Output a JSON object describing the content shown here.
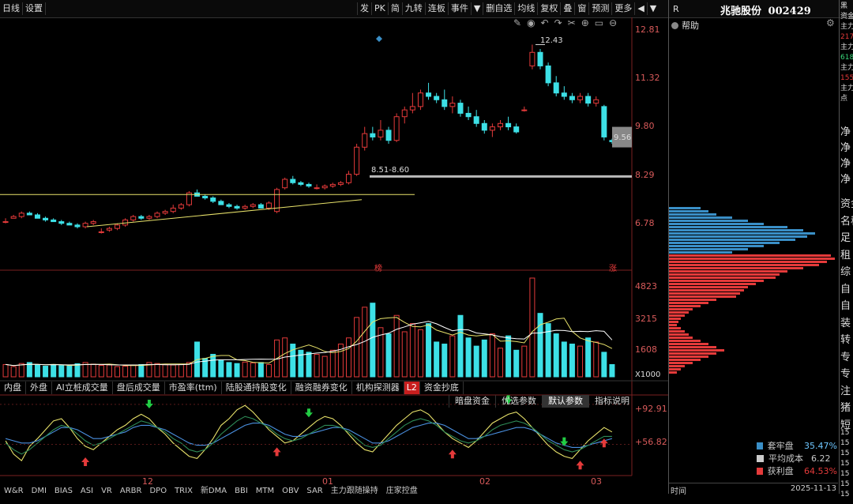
{
  "toolbar": {
    "left": [
      "日线",
      "设置"
    ],
    "right": [
      "发",
      "PK",
      "简",
      "九转",
      "连板",
      "事件",
      "▼",
      "删自选",
      "均线",
      "复权",
      "叠",
      "窗",
      "预测",
      "更多",
      "◀",
      "▼"
    ],
    "right_icons": [
      "pencil-icon",
      "eye-icon",
      "undo-icon",
      "scissors-icon",
      "add-icon",
      "minus-circle-icon"
    ]
  },
  "stock": {
    "market_tag": "R",
    "name": "兆驰股份",
    "code": "002429",
    "help": "帮助"
  },
  "price_axis": [
    "12.81",
    "11.32",
    "9.80",
    "8.29",
    "6.78"
  ],
  "price_annotations": {
    "high": "12.43",
    "current": "9.56",
    "band": "8.51-8.60",
    "marker_1": "榜",
    "marker_2": "涨"
  },
  "volume_axis": [
    "4823",
    "3215",
    "1608",
    "X1000"
  ],
  "indicator_axis": [
    "+92.91",
    "+56.82"
  ],
  "date_axis": [
    "12",
    "01",
    "02",
    "03"
  ],
  "analysis_tabs": [
    "内盘",
    "外盘",
    "AI立桩成交量",
    "盘后成交量",
    "市盈率(ttm)",
    "陆股通持股变化",
    "融资融券变化",
    "机构探测器",
    "L2",
    "资金抄底"
  ],
  "param_tabs": [
    "暗盘资金",
    "优选参数",
    "默认参数",
    "指标说明"
  ],
  "param_active": "默认参数",
  "bottom_tabs": [
    "W&R",
    "DMI",
    "BIAS",
    "ASI",
    "VR",
    "ARBR",
    "DPO",
    "TRIX",
    "新DMA",
    "BBI",
    "MTM",
    "OBV",
    "SAR",
    "主力跟随操持",
    "庄家控盘"
  ],
  "chip_legend": [
    {
      "label": "套牢盘",
      "value": "35.47%",
      "color": "#3a8fc7"
    },
    {
      "label": "平均成本",
      "value": "6.22",
      "color": "#cccccc"
    },
    {
      "label": "获利盘",
      "value": "64.53%",
      "color": "#e43a3a"
    }
  ],
  "chip_footer": {
    "left": "时间",
    "right": "2025-11-13"
  },
  "side_panel": {
    "top": [
      "黑",
      "资金",
      "主力",
      "217",
      "主力",
      "618",
      "主力",
      "155",
      "主力",
      "点"
    ],
    "mid": [
      "净",
      "净",
      "净",
      "净"
    ],
    "list": [
      "资金",
      "名称",
      "足",
      "租",
      "综",
      "自",
      "自",
      "装",
      "转",
      "专",
      "专",
      "注",
      "猪",
      "短"
    ],
    "numbers": [
      "15",
      "15",
      "15",
      "15",
      "15",
      "15",
      "15"
    ]
  },
  "chart_data": [
    {
      "type": "candlestick",
      "title": "",
      "ylim": [
        6.0,
        13.0
      ],
      "ohlc": [
        [
          7.2,
          7.3,
          7.15,
          7.2
        ],
        [
          7.3,
          7.4,
          7.3,
          7.35
        ],
        [
          7.35,
          7.5,
          7.3,
          7.45
        ],
        [
          7.45,
          7.5,
          7.4,
          7.4
        ],
        [
          7.4,
          7.45,
          7.3,
          7.3
        ],
        [
          7.3,
          7.35,
          7.2,
          7.25
        ],
        [
          7.25,
          7.3,
          7.2,
          7.2
        ],
        [
          7.2,
          7.25,
          7.1,
          7.15
        ],
        [
          7.15,
          7.2,
          7.1,
          7.1
        ],
        [
          7.1,
          7.15,
          7.0,
          7.05
        ],
        [
          7.05,
          7.2,
          7.0,
          7.15
        ],
        [
          7.15,
          7.25,
          7.1,
          7.2
        ],
        [
          6.9,
          7.0,
          6.85,
          6.9
        ],
        [
          6.95,
          7.05,
          6.9,
          7.0
        ],
        [
          7.0,
          7.15,
          6.95,
          7.1
        ],
        [
          7.1,
          7.3,
          7.05,
          7.25
        ],
        [
          7.25,
          7.4,
          7.2,
          7.35
        ],
        [
          7.35,
          7.4,
          7.25,
          7.3
        ],
        [
          7.3,
          7.4,
          7.25,
          7.35
        ],
        [
          7.35,
          7.5,
          7.3,
          7.45
        ],
        [
          7.45,
          7.55,
          7.4,
          7.5
        ],
        [
          7.5,
          7.7,
          7.45,
          7.6
        ],
        [
          7.6,
          7.75,
          7.55,
          7.7
        ],
        [
          7.7,
          8.1,
          7.65,
          8.05
        ],
        [
          8.05,
          8.15,
          7.95,
          7.95
        ],
        [
          7.95,
          8.0,
          7.85,
          7.9
        ],
        [
          7.9,
          7.95,
          7.75,
          7.8
        ],
        [
          7.8,
          7.85,
          7.7,
          7.7
        ],
        [
          7.7,
          7.75,
          7.6,
          7.65
        ],
        [
          7.65,
          7.7,
          7.55,
          7.6
        ],
        [
          7.6,
          7.7,
          7.55,
          7.65
        ],
        [
          7.65,
          7.75,
          7.6,
          7.7
        ],
        [
          7.7,
          7.75,
          7.6,
          7.6
        ],
        [
          7.6,
          7.8,
          7.55,
          7.75
        ],
        [
          7.5,
          8.2,
          7.45,
          8.15
        ],
        [
          8.2,
          8.5,
          8.15,
          8.45
        ],
        [
          8.45,
          8.55,
          8.3,
          8.35
        ],
        [
          8.35,
          8.4,
          8.25,
          8.3
        ],
        [
          8.3,
          8.35,
          8.2,
          8.25
        ],
        [
          8.2,
          8.3,
          8.15,
          8.2
        ],
        [
          8.2,
          8.3,
          8.15,
          8.25
        ],
        [
          8.25,
          8.35,
          8.2,
          8.3
        ],
        [
          8.3,
          8.4,
          8.25,
          8.35
        ],
        [
          8.35,
          8.7,
          8.3,
          8.6
        ],
        [
          8.6,
          9.5,
          8.55,
          9.4
        ],
        [
          9.4,
          10.0,
          9.3,
          9.8
        ],
        [
          9.8,
          10.0,
          9.6,
          9.7
        ],
        [
          9.7,
          10.2,
          9.6,
          9.9
        ],
        [
          9.9,
          10.0,
          9.5,
          9.6
        ],
        [
          9.6,
          10.4,
          9.55,
          10.3
        ],
        [
          10.3,
          10.6,
          10.1,
          10.5
        ],
        [
          10.5,
          11.0,
          10.4,
          10.6
        ],
        [
          10.6,
          11.1,
          10.5,
          11.0
        ],
        [
          11.0,
          11.3,
          10.8,
          10.9
        ],
        [
          10.9,
          11.0,
          10.7,
          10.8
        ],
        [
          10.8,
          11.1,
          10.5,
          10.6
        ],
        [
          10.6,
          10.9,
          10.4,
          10.7
        ],
        [
          10.7,
          10.8,
          10.3,
          10.4
        ],
        [
          10.4,
          10.6,
          10.2,
          10.3
        ],
        [
          10.3,
          10.5,
          10.0,
          10.1
        ],
        [
          10.1,
          10.2,
          9.8,
          9.9
        ],
        [
          9.9,
          10.1,
          9.7,
          10.0
        ],
        [
          10.0,
          10.2,
          9.9,
          10.1
        ],
        [
          10.1,
          10.3,
          9.9,
          10.0
        ],
        [
          10.0,
          10.1,
          9.8,
          9.85
        ],
        [
          10.5,
          10.6,
          10.45,
          10.5
        ],
        [
          11.8,
          12.43,
          11.7,
          12.2
        ],
        [
          12.2,
          12.3,
          11.7,
          11.8
        ],
        [
          11.8,
          11.9,
          11.2,
          11.3
        ],
        [
          11.3,
          11.5,
          10.9,
          11.0
        ],
        [
          11.0,
          11.2,
          10.8,
          10.9
        ],
        [
          10.9,
          11.0,
          10.7,
          10.8
        ],
        [
          10.8,
          11.0,
          10.7,
          10.9
        ],
        [
          10.9,
          11.0,
          10.6,
          10.7
        ],
        [
          10.7,
          10.9,
          10.6,
          10.8
        ],
        [
          10.6,
          10.65,
          9.6,
          9.7
        ],
        [
          9.6,
          9.65,
          9.5,
          9.56
        ]
      ],
      "ma_lines": [
        {
          "name": "",
          "points": [
            [
              0,
              7.05
            ],
            [
              10,
              7.3
            ],
            [
              20,
              7.6
            ],
            [
              32,
              8.05
            ]
          ],
          "color": "#e8e26a"
        },
        {
          "name": "",
          "points": [
            [
              0,
              8.0
            ],
            [
              37,
              8.0
            ]
          ],
          "color": "#e8e26a"
        }
      ]
    },
    {
      "type": "bar",
      "title": "",
      "ylabel": "X1000",
      "ylim": [
        0,
        4823
      ],
      "values": [
        600,
        500,
        650,
        700,
        580,
        520,
        600,
        550,
        530,
        640,
        700,
        620,
        560,
        580,
        500,
        520,
        580,
        600,
        700,
        650,
        600,
        580,
        620,
        700,
        1700,
        900,
        1100,
        800,
        700,
        650,
        720,
        680,
        700,
        600,
        1800,
        1900,
        1600,
        1300,
        1200,
        1100,
        1000,
        1300,
        1600,
        1900,
        2900,
        3400,
        3600,
        2400,
        2100,
        3000,
        2200,
        2600,
        2300,
        2600,
        1700,
        1600,
        2000,
        3000,
        1900,
        1500,
        1800,
        2100,
        1400,
        2000,
        1300,
        1500,
        4823,
        3100,
        2600,
        2100,
        1700,
        1600,
        1500,
        1900,
        1700,
        1200,
        600
      ],
      "ma_lines": [
        {
          "name": "",
          "color": "#e8e26a"
        },
        {
          "name": "",
          "color": "#ffffff"
        }
      ]
    },
    {
      "type": "line",
      "title": "",
      "ylim": [
        30,
        100
      ],
      "series": [
        {
          "name": "",
          "color": "#e8e26a",
          "values": [
            60,
            48,
            42,
            55,
            62,
            70,
            78,
            80,
            72,
            62,
            55,
            52,
            58,
            64,
            70,
            74,
            80,
            84,
            80,
            72,
            66,
            58,
            52,
            46,
            44,
            52,
            62,
            74,
            80,
            88,
            92,
            86,
            78,
            70,
            64,
            58,
            60,
            66,
            72,
            78,
            82,
            80,
            74,
            66,
            58,
            52,
            50,
            58,
            66,
            74,
            80,
            86,
            88,
            84,
            76,
            68,
            62,
            58,
            54,
            60,
            68,
            76,
            80,
            84,
            86,
            80,
            72,
            64,
            56,
            50,
            46,
            44,
            52,
            60,
            66,
            72,
            68
          ]
        },
        {
          "name": "",
          "color": "#4a90e0",
          "values": [
            62,
            60,
            58,
            58,
            60,
            64,
            68,
            72,
            72,
            70,
            66,
            62,
            62,
            64,
            66,
            68,
            72,
            74,
            74,
            72,
            70,
            66,
            62,
            58,
            56,
            56,
            58,
            62,
            66,
            70,
            74,
            76,
            76,
            74,
            70,
            66,
            64,
            64,
            66,
            68,
            70,
            72,
            72,
            70,
            66,
            62,
            58,
            58,
            60,
            64,
            68,
            72,
            74,
            76,
            76,
            74,
            70,
            66,
            62,
            62,
            64,
            66,
            68,
            70,
            72,
            72,
            70,
            66,
            62,
            58,
            56,
            54,
            54,
            56,
            58,
            60,
            62
          ]
        },
        {
          "name": "",
          "color": "#2e8b57",
          "values": [
            58,
            52,
            48,
            52,
            58,
            64,
            70,
            74,
            72,
            66,
            60,
            56,
            58,
            62,
            66,
            70,
            74,
            78,
            76,
            72,
            68,
            62,
            58,
            52,
            50,
            52,
            58,
            66,
            72,
            78,
            82,
            80,
            76,
            72,
            66,
            62,
            60,
            62,
            66,
            70,
            74,
            74,
            72,
            68,
            62,
            56,
            54,
            56,
            62,
            68,
            74,
            78,
            80,
            78,
            74,
            68,
            64,
            60,
            58,
            60,
            64,
            70,
            74,
            76,
            78,
            76,
            72,
            66,
            60,
            56,
            52,
            50,
            52,
            56,
            60,
            64,
            64
          ]
        }
      ],
      "signals_up": [
        10,
        34,
        56,
        72,
        75
      ],
      "signals_down": [
        18,
        38,
        63,
        70
      ]
    }
  ]
}
